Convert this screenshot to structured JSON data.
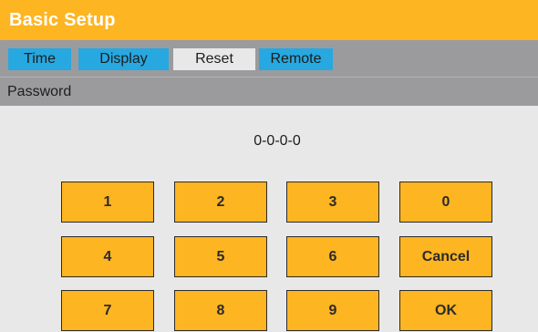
{
  "window": {
    "title": "Basic Setup"
  },
  "tabs": [
    {
      "label": "Time",
      "active": false
    },
    {
      "label": "Display",
      "active": false
    },
    {
      "label": "Reset",
      "active": true
    },
    {
      "label": "Remote",
      "active": false
    }
  ],
  "section": {
    "label": "Password"
  },
  "password": {
    "value": "0-0-0-0"
  },
  "keypad": {
    "keys": [
      "1",
      "2",
      "3",
      "0",
      "4",
      "5",
      "6",
      "Cancel",
      "7",
      "8",
      "9",
      "OK"
    ]
  },
  "colors": {
    "accent": "#fdb521",
    "tab_blue": "#27a8e0",
    "strip_gray": "#9b9b9d",
    "background": "#e8e8e8"
  }
}
